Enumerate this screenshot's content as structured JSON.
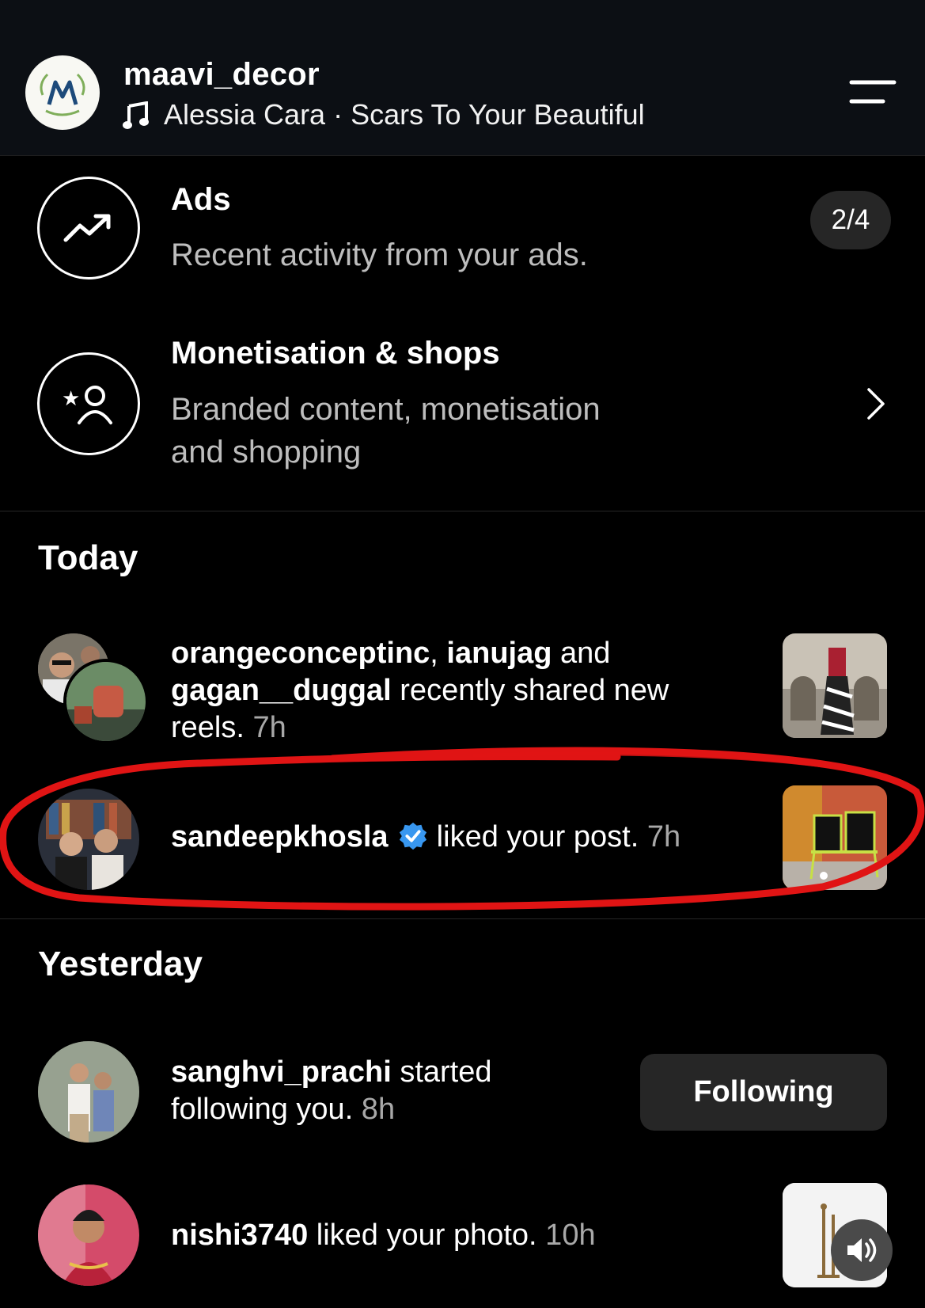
{
  "header": {
    "username": "maavi_decor",
    "song": "Alessia Cara · Scars To Your Beautiful"
  },
  "tools": [
    {
      "title": "Ads",
      "subtitle": "Recent activity from your ads.",
      "badge": "2/4"
    },
    {
      "title": "Monetisation & shops",
      "subtitle_line1": "Branded content, monetisation",
      "subtitle_line2": "and shopping"
    }
  ],
  "sections": {
    "today": "Today",
    "yesterday": "Yesterday"
  },
  "notifications": {
    "reels": {
      "user1": "orangeconceptinc",
      "sep1": ", ",
      "user2": "ianujag",
      "and": " and",
      "user3": "gagan__duggal",
      "text": " recently shared new",
      "text2": "reels.",
      "time": " 7h"
    },
    "like_post": {
      "user": "sandeepkhosla",
      "text": " liked your post.",
      "time": " 7h"
    },
    "follow": {
      "user": "sanghvi_prachi",
      "text": " started",
      "text2": "following you.",
      "time": " 8h",
      "button": "Following"
    },
    "like_photo": {
      "user": "nishi3740",
      "text": " liked your photo.",
      "time": " 10h"
    }
  },
  "colors": {
    "background": "#000000",
    "header_bg": "#0c0f14",
    "verified": "#3897f0",
    "highlight": "#e01414",
    "button_bg": "#262626"
  }
}
